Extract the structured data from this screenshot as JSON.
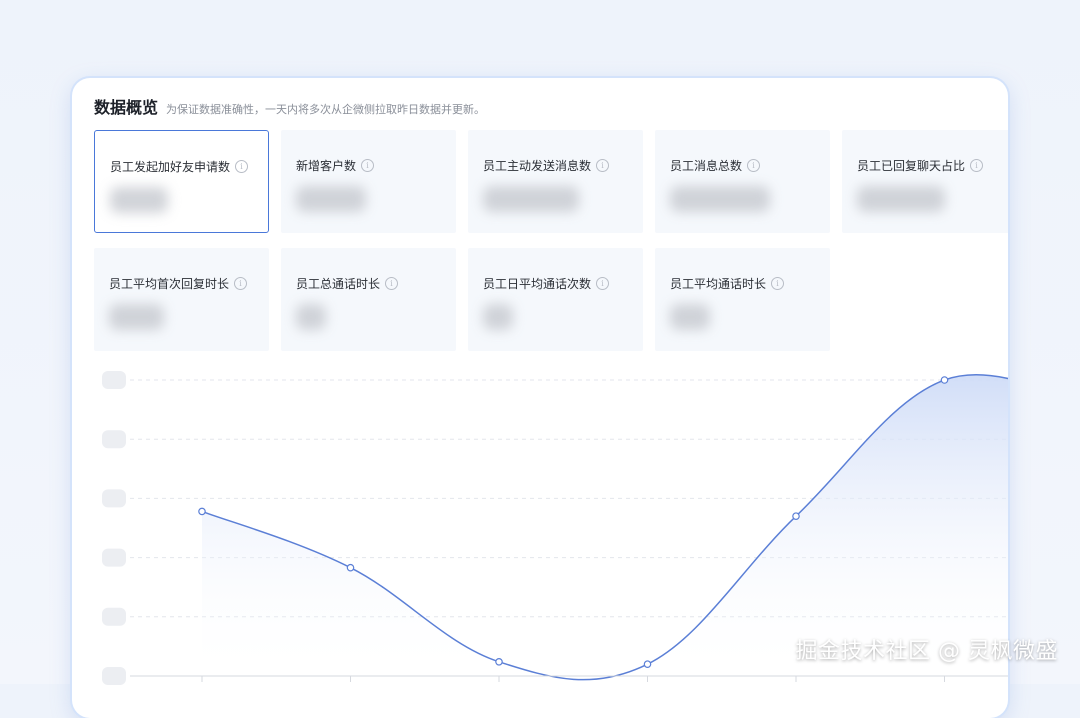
{
  "header": {
    "title": "数据概览",
    "note": "为保证数据准确性，一天内将多次从企微侧拉取昨日数据并更新。"
  },
  "metrics": [
    {
      "label": "员工发起加好友申请数",
      "value": "",
      "selected": true
    },
    {
      "label": "新增客户数",
      "value": ""
    },
    {
      "label": "员工主动发送消息数",
      "value": ""
    },
    {
      "label": "员工消息总数",
      "value": ""
    },
    {
      "label": "员工已回复聊天占比",
      "value": ""
    },
    {
      "label": "员工平均首次回复时长",
      "value": ""
    },
    {
      "label": "员工总通话时长",
      "value": ""
    },
    {
      "label": "员工日平均通话次数",
      "value": ""
    },
    {
      "label": "员工平均通话时长",
      "value": ""
    }
  ],
  "info_icon_glyph": "i",
  "icons": {
    "info": "info-circle-icon"
  },
  "chart_data": {
    "type": "area",
    "x": [
      1,
      2,
      3,
      4,
      5,
      6,
      7
    ],
    "series": [
      {
        "values": [
          2.78,
          1.83,
          0.24,
          0.2,
          2.7,
          5.0,
          4.55
        ]
      }
    ],
    "ylim": [
      0,
      5
    ],
    "grid": true,
    "color": "#5b7fd6",
    "fill_top": "#cfdcf7"
  },
  "watermark": "掘金技术社区 @ 灵枫微盛"
}
